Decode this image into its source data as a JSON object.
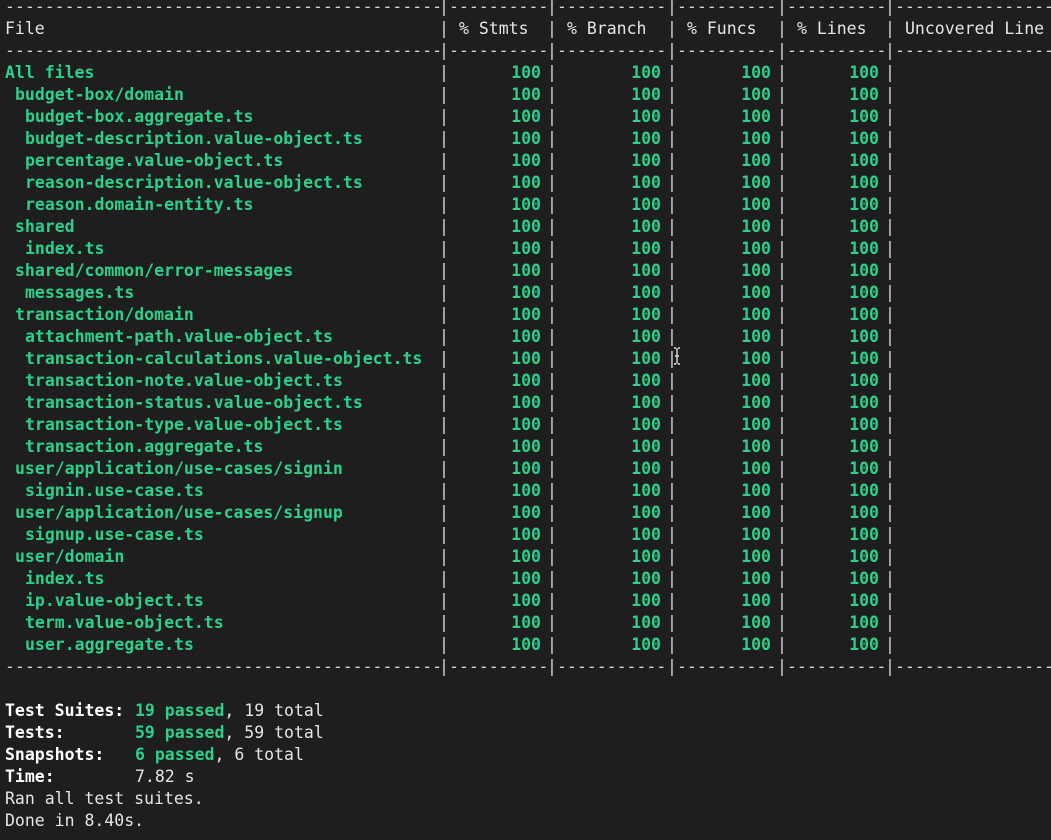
{
  "table": {
    "header": {
      "file": "File",
      "stmts": "% Stmts",
      "branch": "% Branch",
      "funcs": "% Funcs",
      "lines": "% Lines",
      "uncovered": "Uncovered Line #s"
    },
    "rows": [
      {
        "name": "All files",
        "indent": 0,
        "stmts": "100",
        "branch": "100",
        "funcs": "100",
        "lines": "100",
        "uncovered": ""
      },
      {
        "name": "budget-box/domain",
        "indent": 1,
        "stmts": "100",
        "branch": "100",
        "funcs": "100",
        "lines": "100",
        "uncovered": ""
      },
      {
        "name": "budget-box.aggregate.ts",
        "indent": 2,
        "stmts": "100",
        "branch": "100",
        "funcs": "100",
        "lines": "100",
        "uncovered": ""
      },
      {
        "name": "budget-description.value-object.ts",
        "indent": 2,
        "stmts": "100",
        "branch": "100",
        "funcs": "100",
        "lines": "100",
        "uncovered": ""
      },
      {
        "name": "percentage.value-object.ts",
        "indent": 2,
        "stmts": "100",
        "branch": "100",
        "funcs": "100",
        "lines": "100",
        "uncovered": ""
      },
      {
        "name": "reason-description.value-object.ts",
        "indent": 2,
        "stmts": "100",
        "branch": "100",
        "funcs": "100",
        "lines": "100",
        "uncovered": ""
      },
      {
        "name": "reason.domain-entity.ts",
        "indent": 2,
        "stmts": "100",
        "branch": "100",
        "funcs": "100",
        "lines": "100",
        "uncovered": ""
      },
      {
        "name": "shared",
        "indent": 1,
        "stmts": "100",
        "branch": "100",
        "funcs": "100",
        "lines": "100",
        "uncovered": ""
      },
      {
        "name": "index.ts",
        "indent": 2,
        "stmts": "100",
        "branch": "100",
        "funcs": "100",
        "lines": "100",
        "uncovered": ""
      },
      {
        "name": "shared/common/error-messages",
        "indent": 1,
        "stmts": "100",
        "branch": "100",
        "funcs": "100",
        "lines": "100",
        "uncovered": ""
      },
      {
        "name": "messages.ts",
        "indent": 2,
        "stmts": "100",
        "branch": "100",
        "funcs": "100",
        "lines": "100",
        "uncovered": ""
      },
      {
        "name": "transaction/domain",
        "indent": 1,
        "stmts": "100",
        "branch": "100",
        "funcs": "100",
        "lines": "100",
        "uncovered": ""
      },
      {
        "name": "attachment-path.value-object.ts",
        "indent": 2,
        "stmts": "100",
        "branch": "100",
        "funcs": "100",
        "lines": "100",
        "uncovered": ""
      },
      {
        "name": "transaction-calculations.value-object.ts",
        "indent": 2,
        "stmts": "100",
        "branch": "100",
        "funcs": "100",
        "lines": "100",
        "uncovered": ""
      },
      {
        "name": "transaction-note.value-object.ts",
        "indent": 2,
        "stmts": "100",
        "branch": "100",
        "funcs": "100",
        "lines": "100",
        "uncovered": ""
      },
      {
        "name": "transaction-status.value-object.ts",
        "indent": 2,
        "stmts": "100",
        "branch": "100",
        "funcs": "100",
        "lines": "100",
        "uncovered": ""
      },
      {
        "name": "transaction-type.value-object.ts",
        "indent": 2,
        "stmts": "100",
        "branch": "100",
        "funcs": "100",
        "lines": "100",
        "uncovered": ""
      },
      {
        "name": "transaction.aggregate.ts",
        "indent": 2,
        "stmts": "100",
        "branch": "100",
        "funcs": "100",
        "lines": "100",
        "uncovered": ""
      },
      {
        "name": "user/application/use-cases/signin",
        "indent": 1,
        "stmts": "100",
        "branch": "100",
        "funcs": "100",
        "lines": "100",
        "uncovered": ""
      },
      {
        "name": "signin.use-case.ts",
        "indent": 2,
        "stmts": "100",
        "branch": "100",
        "funcs": "100",
        "lines": "100",
        "uncovered": ""
      },
      {
        "name": "user/application/use-cases/signup",
        "indent": 1,
        "stmts": "100",
        "branch": "100",
        "funcs": "100",
        "lines": "100",
        "uncovered": ""
      },
      {
        "name": "signup.use-case.ts",
        "indent": 2,
        "stmts": "100",
        "branch": "100",
        "funcs": "100",
        "lines": "100",
        "uncovered": ""
      },
      {
        "name": "user/domain",
        "indent": 1,
        "stmts": "100",
        "branch": "100",
        "funcs": "100",
        "lines": "100",
        "uncovered": ""
      },
      {
        "name": "index.ts",
        "indent": 2,
        "stmts": "100",
        "branch": "100",
        "funcs": "100",
        "lines": "100",
        "uncovered": ""
      },
      {
        "name": "ip.value-object.ts",
        "indent": 2,
        "stmts": "100",
        "branch": "100",
        "funcs": "100",
        "lines": "100",
        "uncovered": ""
      },
      {
        "name": "term.value-object.ts",
        "indent": 2,
        "stmts": "100",
        "branch": "100",
        "funcs": "100",
        "lines": "100",
        "uncovered": ""
      },
      {
        "name": "user.aggregate.ts",
        "indent": 2,
        "stmts": "100",
        "branch": "100",
        "funcs": "100",
        "lines": "100",
        "uncovered": ""
      }
    ]
  },
  "summary": {
    "test_suites_label": "Test Suites:",
    "test_suites_passed": "19 passed",
    "test_suites_total": ", 19 total",
    "tests_label": "Tests:",
    "tests_passed": "59 passed",
    "tests_total": ", 59 total",
    "snapshots_label": "Snapshots:",
    "snapshots_passed": "6 passed",
    "snapshots_total": ", 6 total",
    "time_label": "Time:",
    "time_value": "7.82 s",
    "ran_all": "Ran all test suites.",
    "done": "Done in 8.40s."
  },
  "colors": {
    "background": "#1e1e1e",
    "text": "#d4d4d4",
    "pass_green": "#2bd18a"
  }
}
